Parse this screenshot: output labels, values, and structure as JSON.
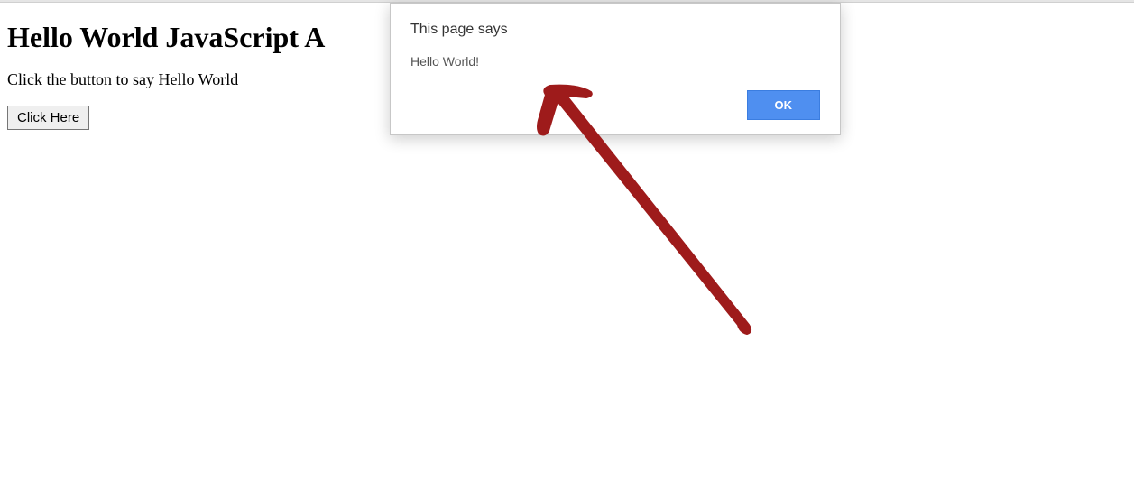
{
  "page": {
    "heading": "Hello World JavaScript A",
    "instruction": "Click the button to say Hello World",
    "button_label": "Click Here"
  },
  "alert": {
    "title": "This page says",
    "message": "Hello World!",
    "ok_label": "OK"
  },
  "annotation": {
    "arrow_color": "#9e1b1b"
  }
}
